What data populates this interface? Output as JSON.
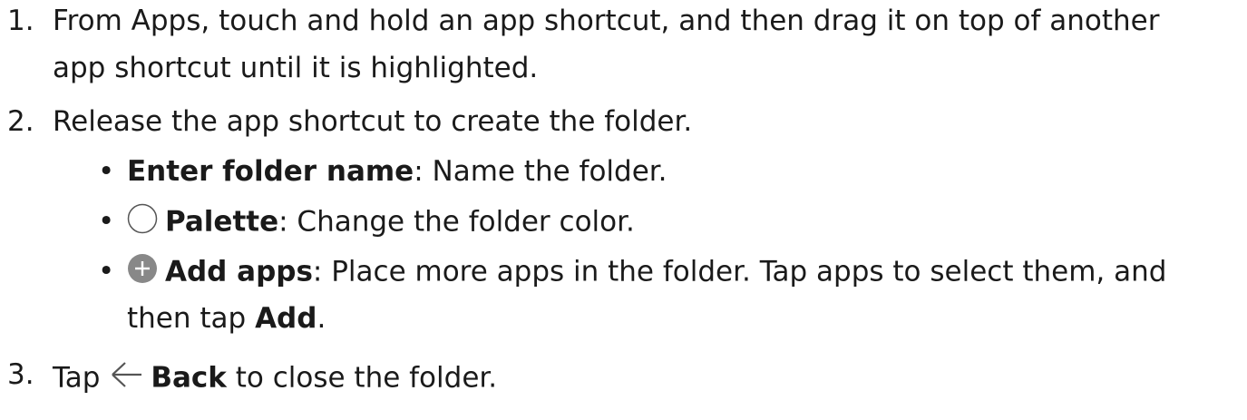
{
  "steps": [
    {
      "number": "1.",
      "line1": "From Apps, touch and hold an app shortcut, and then drag it on top of another",
      "line2": "app shortcut until it is highlighted."
    },
    {
      "number": "2.",
      "line1": "Release the app shortcut to create the folder.",
      "bullets": [
        {
          "term": "Enter folder name",
          "desc": ": Name the folder."
        },
        {
          "icon": "palette-circle-icon",
          "term": "Palette",
          "desc": ": Change the folder color."
        },
        {
          "icon": "add-plus-icon",
          "term": "Add apps",
          "desc": ": Place more apps in the folder. Tap apps to select them, and",
          "line2_prefix": "then tap ",
          "line2_term": "Add",
          "line2_suffix": "."
        }
      ]
    },
    {
      "number": "3.",
      "prefix": "Tap ",
      "icon": "back-arrow-icon",
      "term": "Back",
      "suffix": " to close the folder."
    }
  ],
  "bullet_char": "•",
  "colors": {
    "text": "#1a1a1a",
    "icon_gray": "#888888",
    "icon_outline": "#555555"
  }
}
